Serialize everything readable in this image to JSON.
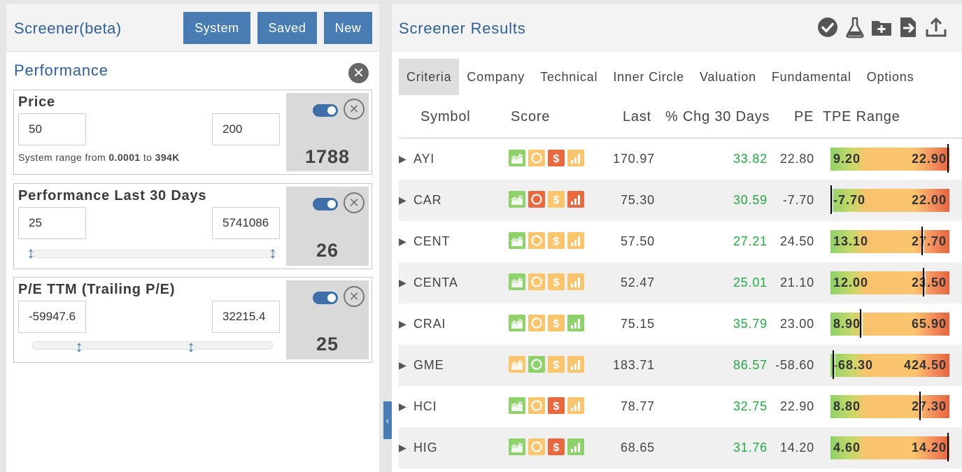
{
  "screener": {
    "title": "Screener(beta)",
    "buttons": [
      "System",
      "Saved",
      "New"
    ],
    "section_title": "Performance",
    "filters": [
      {
        "title": "Price",
        "min": "50",
        "max": "200",
        "count": "1788",
        "note_prefix": "System range from ",
        "note_min": "0.0001",
        "note_mid": " to ",
        "note_max": "394K",
        "enabled": true
      },
      {
        "title": "Performance Last 30 Days",
        "min": "25",
        "max": "5741086",
        "count": "26",
        "enabled": true
      },
      {
        "title": "P/E TTM (Trailing P/E)",
        "min": "-59947.6",
        "max": "32215.4",
        "count": "25",
        "enabled": true
      }
    ]
  },
  "results": {
    "title": "Screener Results",
    "icons": [
      "check-circle-icon",
      "flask-icon",
      "add-folder-icon",
      "export-file-icon",
      "upload-icon"
    ],
    "tabs": [
      "Criteria",
      "Company",
      "Technical",
      "Inner Circle",
      "Valuation",
      "Fundamental",
      "Options"
    ],
    "active_tab": "Criteria",
    "columns": [
      "Symbol",
      "Score",
      "Last",
      "% Chg 30 Days",
      "PE",
      "TPE Range"
    ],
    "rows": [
      {
        "symbol": "AYI",
        "last": "170.97",
        "chg": "33.82",
        "pe": "22.80",
        "lo": "9.20",
        "hi": "22.90",
        "pos": 1.0,
        "score": [
          "green",
          "yellow",
          "orange",
          "yellow"
        ]
      },
      {
        "symbol": "CAR",
        "last": "75.30",
        "chg": "30.59",
        "pe": "-7.70",
        "lo": "-7.70",
        "hi": "22.00",
        "pos": 0.0,
        "score": [
          "green",
          "orange",
          "yellow",
          "orange"
        ]
      },
      {
        "symbol": "CENT",
        "last": "57.50",
        "chg": "27.21",
        "pe": "24.50",
        "lo": "13.10",
        "hi": "27.70",
        "pos": 0.78,
        "score": [
          "green",
          "yellow",
          "yellow",
          "yellow"
        ]
      },
      {
        "symbol": "CENTA",
        "last": "52.47",
        "chg": "25.01",
        "pe": "21.10",
        "lo": "12.00",
        "hi": "23.50",
        "pos": 0.79,
        "score": [
          "green",
          "yellow",
          "yellow",
          "yellow"
        ]
      },
      {
        "symbol": "CRAI",
        "last": "75.15",
        "chg": "35.79",
        "pe": "23.00",
        "lo": "8.90",
        "hi": "65.90",
        "pos": 0.25,
        "score": [
          "green",
          "yellow",
          "yellow",
          "green"
        ]
      },
      {
        "symbol": "GME",
        "last": "183.71",
        "chg": "86.57",
        "pe": "-58.60",
        "lo": "-68.30",
        "hi": "424.50",
        "pos": 0.02,
        "score": [
          "yellow",
          "green",
          "yellow",
          "yellow"
        ]
      },
      {
        "symbol": "HCI",
        "last": "78.77",
        "chg": "32.75",
        "pe": "22.90",
        "lo": "8.80",
        "hi": "27.30",
        "pos": 0.76,
        "score": [
          "green",
          "yellow",
          "orange",
          "yellow"
        ]
      },
      {
        "symbol": "HIG",
        "last": "68.65",
        "chg": "31.76",
        "pe": "14.20",
        "lo": "4.60",
        "hi": "14.20",
        "pos": 1.0,
        "score": [
          "green",
          "yellow",
          "orange",
          "green"
        ]
      }
    ]
  },
  "colors": {
    "accent": "#4a7cb4",
    "title": "#2f5f95",
    "positive": "#27a844",
    "score_green": "#8fd16a",
    "score_yellow": "#fbc56e",
    "score_orange": "#e8693f"
  }
}
